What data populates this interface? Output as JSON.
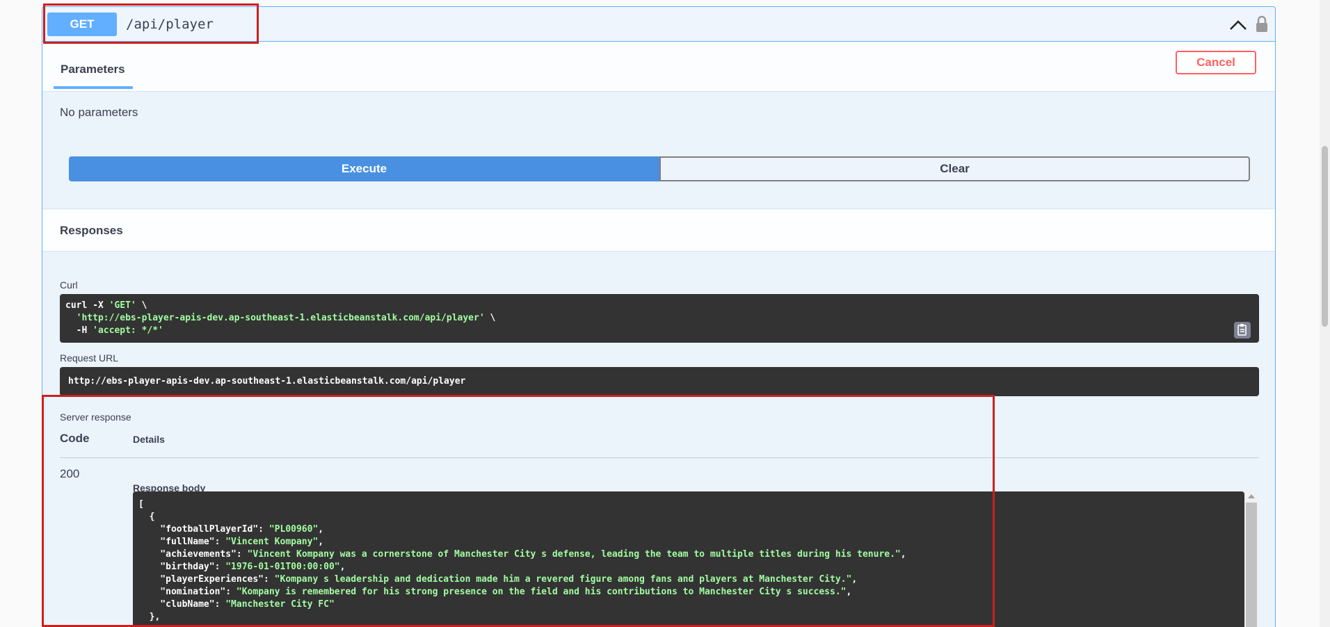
{
  "operation": {
    "method": "GET",
    "path": "/api/player"
  },
  "tabs": {
    "parameters_label": "Parameters",
    "cancel_label": "Cancel",
    "no_parameters": "No parameters"
  },
  "actions": {
    "execute_label": "Execute",
    "clear_label": "Clear"
  },
  "responses": {
    "title": "Responses",
    "curl_label": "Curl",
    "curl_lines": [
      "curl -X 'GET' \\",
      "  'http://ebs-player-apis-dev.ap-southeast-1.elasticbeanstalk.com/api/player' \\",
      "  -H 'accept: */*'"
    ],
    "request_url_label": "Request URL",
    "request_url": "http://ebs-player-apis-dev.ap-southeast-1.elasticbeanstalk.com/api/player",
    "server_response_label": "Server response",
    "code_header": "Code",
    "details_header": "Details",
    "status_code": "200",
    "response_body_label": "Response body",
    "body_lines": [
      "[",
      "  {",
      "    \"footballPlayerId\": \"PL00960\",",
      "    \"fullName\": \"Vincent Kompany\",",
      "    \"achievements\": \"Vincent Kompany was a cornerstone of Manchester City s defense, leading the team to multiple titles during his tenure.\",",
      "    \"birthday\": \"1976-01-01T00:00:00\",",
      "    \"playerExperiences\": \"Kompany s leadership and dedication made him a revered figure among fans and players at Manchester City.\",",
      "    \"nomination\": \"Kompany is remembered for his strong presence on the field and his contributions to Manchester City s success.\",",
      "    \"clubName\": \"Manchester City FC\"",
      "  },"
    ]
  },
  "colors": {
    "get_accent": "#61affe",
    "execute_blue": "#4990e2",
    "cancel_red": "#ff6060",
    "highlight_red": "#cc1f1f",
    "code_bg": "#333333",
    "string_green": "#a2fca2"
  },
  "icons": {
    "collapse": "chevron-up-icon",
    "lock": "lock-icon",
    "copy": "clipboard-icon"
  }
}
